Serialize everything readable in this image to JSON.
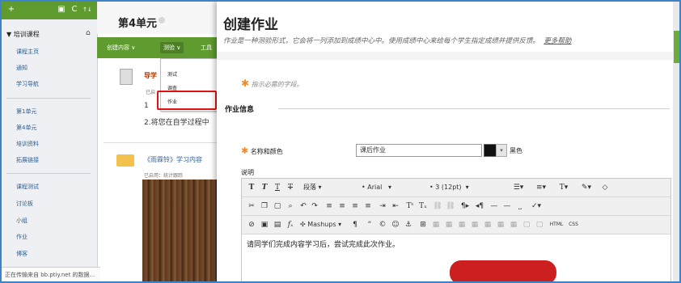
{
  "sidebar": {
    "toolbar": {
      "add": "+",
      "refresh": "C",
      "sort": "↑↓"
    },
    "header": "培训课程",
    "items": [
      {
        "label": "课程主页"
      },
      {
        "label": "通知"
      },
      {
        "label": "学习导航"
      },
      {
        "label": "第1单元"
      },
      {
        "label": "第4单元"
      },
      {
        "label": "培训资料"
      },
      {
        "label": "拓展链接"
      },
      {
        "label": "课程测试"
      },
      {
        "label": "讨论板"
      },
      {
        "label": "小组"
      },
      {
        "label": "作业"
      },
      {
        "label": "博客"
      }
    ],
    "status": "正在传输来自 bb.ptiy.net 的数据..."
  },
  "content": {
    "unit_title": "第4单元",
    "action_bar": {
      "create_content": "创建内容 ∨",
      "tests": "测验 ∨",
      "tools": "工具"
    },
    "menu": {
      "items": [
        "测试",
        "调查",
        "作业"
      ]
    },
    "item1": {
      "title": "导学",
      "meta": "已启",
      "line1": "1",
      "line2": "2.将您在自学过程中"
    },
    "item2": {
      "title": "《雨霖铃》学习内容",
      "meta": "已启用：统计跟踪"
    }
  },
  "panel": {
    "title": "创建作业",
    "subtitle": "作业是一种测验形式，它会将一列添加到成绩中心中。使用成绩中心来给每个学生指定成绩并提供反馈。",
    "more_help": "更多帮助",
    "required_note": "指示必需的字段。",
    "section_title": "作业信息",
    "name_label": "名称和颜色",
    "name_value": "课后作业",
    "color_name": "黑色",
    "desc_label": "说明",
    "toolbar": {
      "paragraph": "段落",
      "font": "Arial",
      "size": "3 (12pt)",
      "mashups": "Mashups",
      "html": "HTML",
      "css": "CSS"
    },
    "editor_text": "请同学们完成内容学习后，尝试完成此次作业。"
  },
  "colors": {
    "green": "#5f9b2f",
    "accent_orange": "#f08c28",
    "frame_blue": "#3e83c7",
    "highlight_red": "#e31212"
  }
}
